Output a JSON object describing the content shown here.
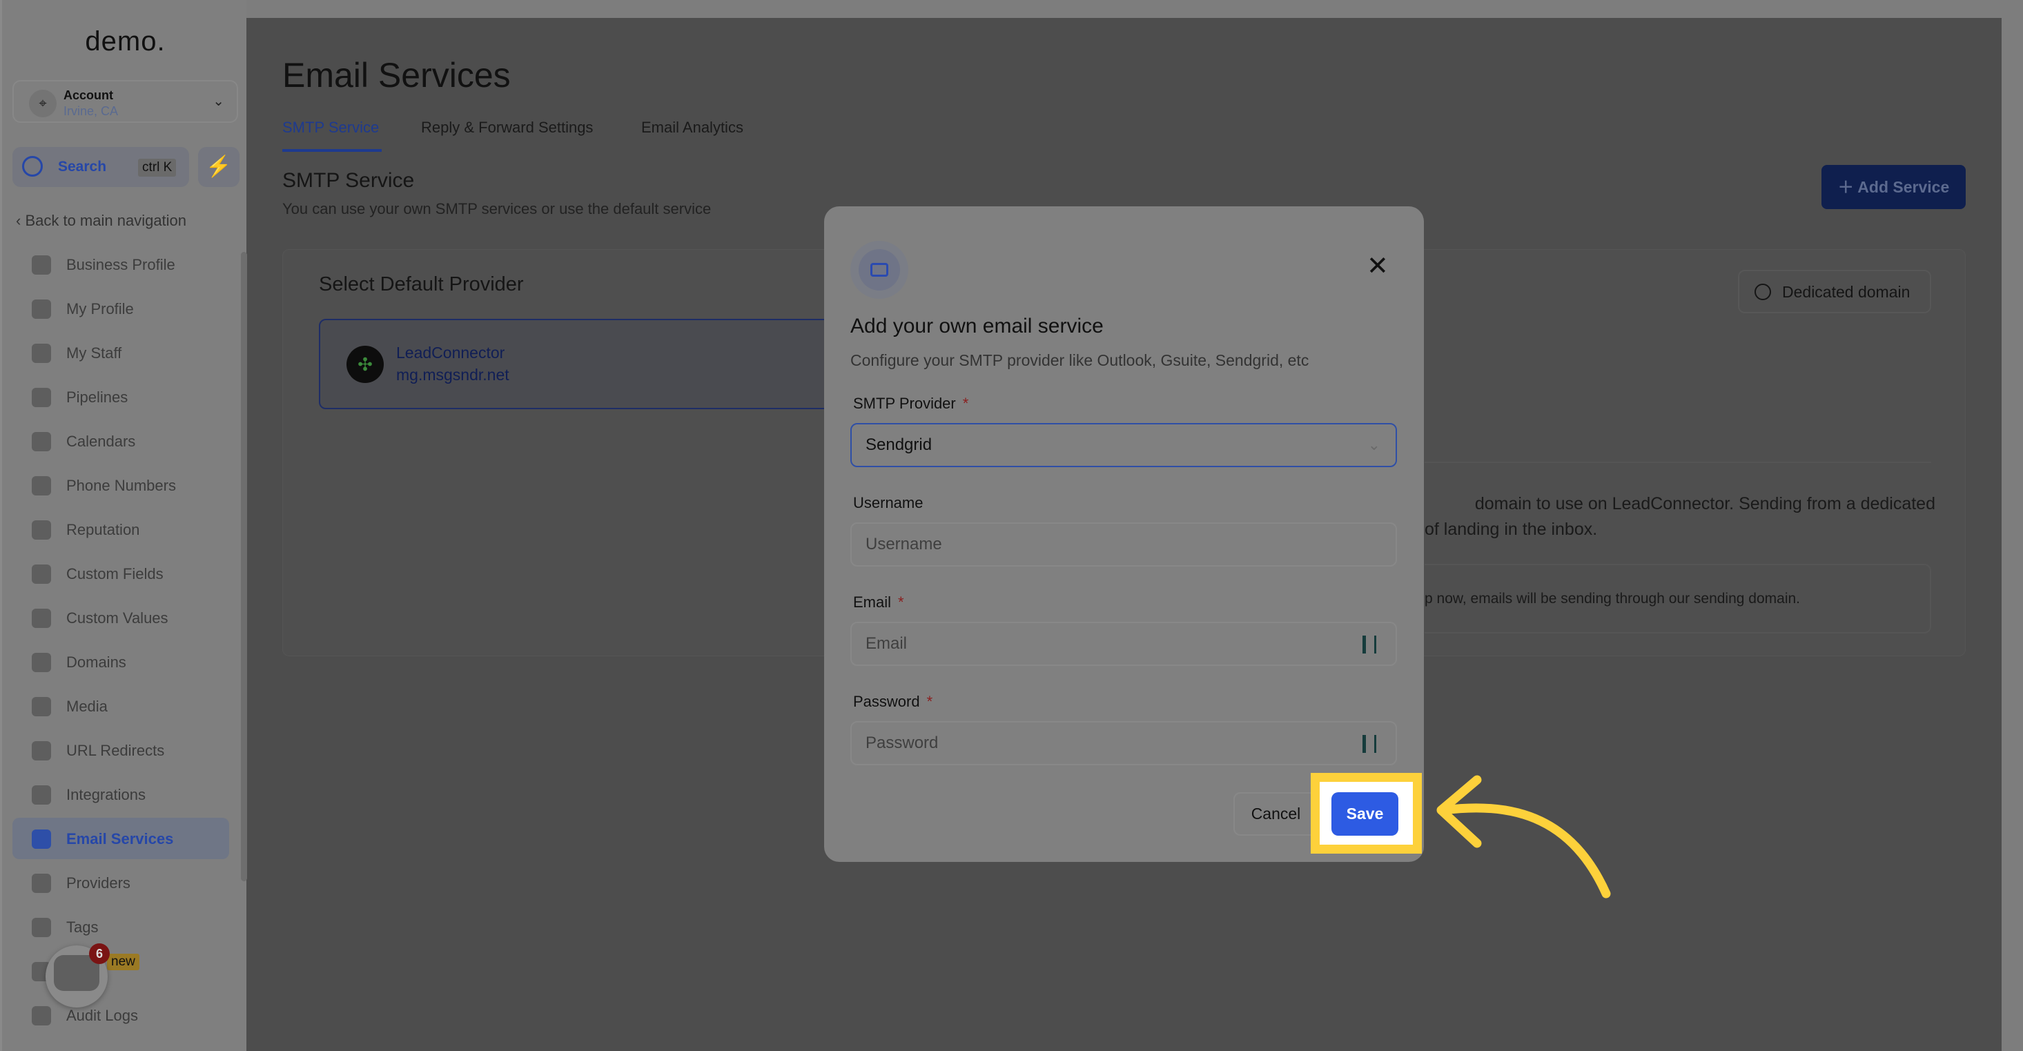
{
  "sidebar": {
    "logo": "demo.",
    "account": {
      "name": "Account",
      "location": "Irvine, CA"
    },
    "search": {
      "label": "Search",
      "shortcut": "ctrl K"
    },
    "back": "Back to main navigation",
    "items": [
      {
        "label": "Business Profile"
      },
      {
        "label": "My Profile"
      },
      {
        "label": "My Staff"
      },
      {
        "label": "Pipelines"
      },
      {
        "label": "Calendars"
      },
      {
        "label": "Phone Numbers"
      },
      {
        "label": "Reputation"
      },
      {
        "label": "Custom Fields"
      },
      {
        "label": "Custom Values"
      },
      {
        "label": "Domains"
      },
      {
        "label": "Media"
      },
      {
        "label": "URL Redirects"
      },
      {
        "label": "Integrations"
      },
      {
        "label": "Email Services"
      },
      {
        "label": "Providers"
      },
      {
        "label": "Tags"
      },
      {
        "label": ""
      },
      {
        "label": "Audit Logs"
      }
    ],
    "active": "Email Services",
    "chat_badge": "6",
    "new_badge": "new"
  },
  "main": {
    "title": "Email Services",
    "tabs": [
      {
        "label": "SMTP Service"
      },
      {
        "label": "Reply & Forward Settings"
      },
      {
        "label": "Email Analytics"
      }
    ],
    "section_title": "SMTP Service",
    "section_sub": "You can use your own SMTP services or use the default service",
    "add_service": "Add Service",
    "select_default": "Select Default Provider",
    "provider": {
      "name": "LeadConnector",
      "domain": "mg.msgsndr.net"
    },
    "dedicated_domain": "Dedicated domain",
    "desc_line1": "domain to use on LeadConnector. Sending from a dedicated",
    "desc_line2": "of landing in the inbox.",
    "info_text": "p now, emails will be sending through our sending domain."
  },
  "modal": {
    "title": "Add your own email service",
    "subtitle": "Configure your SMTP provider like Outlook, Gsuite, Sendgrid, etc",
    "provider_label": "SMTP Provider",
    "provider_value": "Sendgrid",
    "username_label": "Username",
    "username_placeholder": "Username",
    "email_label": "Email",
    "email_placeholder": "Email",
    "password_label": "Password",
    "password_placeholder": "Password",
    "required_mark": "*",
    "cancel": "Cancel",
    "save": "Save"
  },
  "colors": {
    "highlight": "#fdd13b",
    "primary": "#2d5be3"
  }
}
